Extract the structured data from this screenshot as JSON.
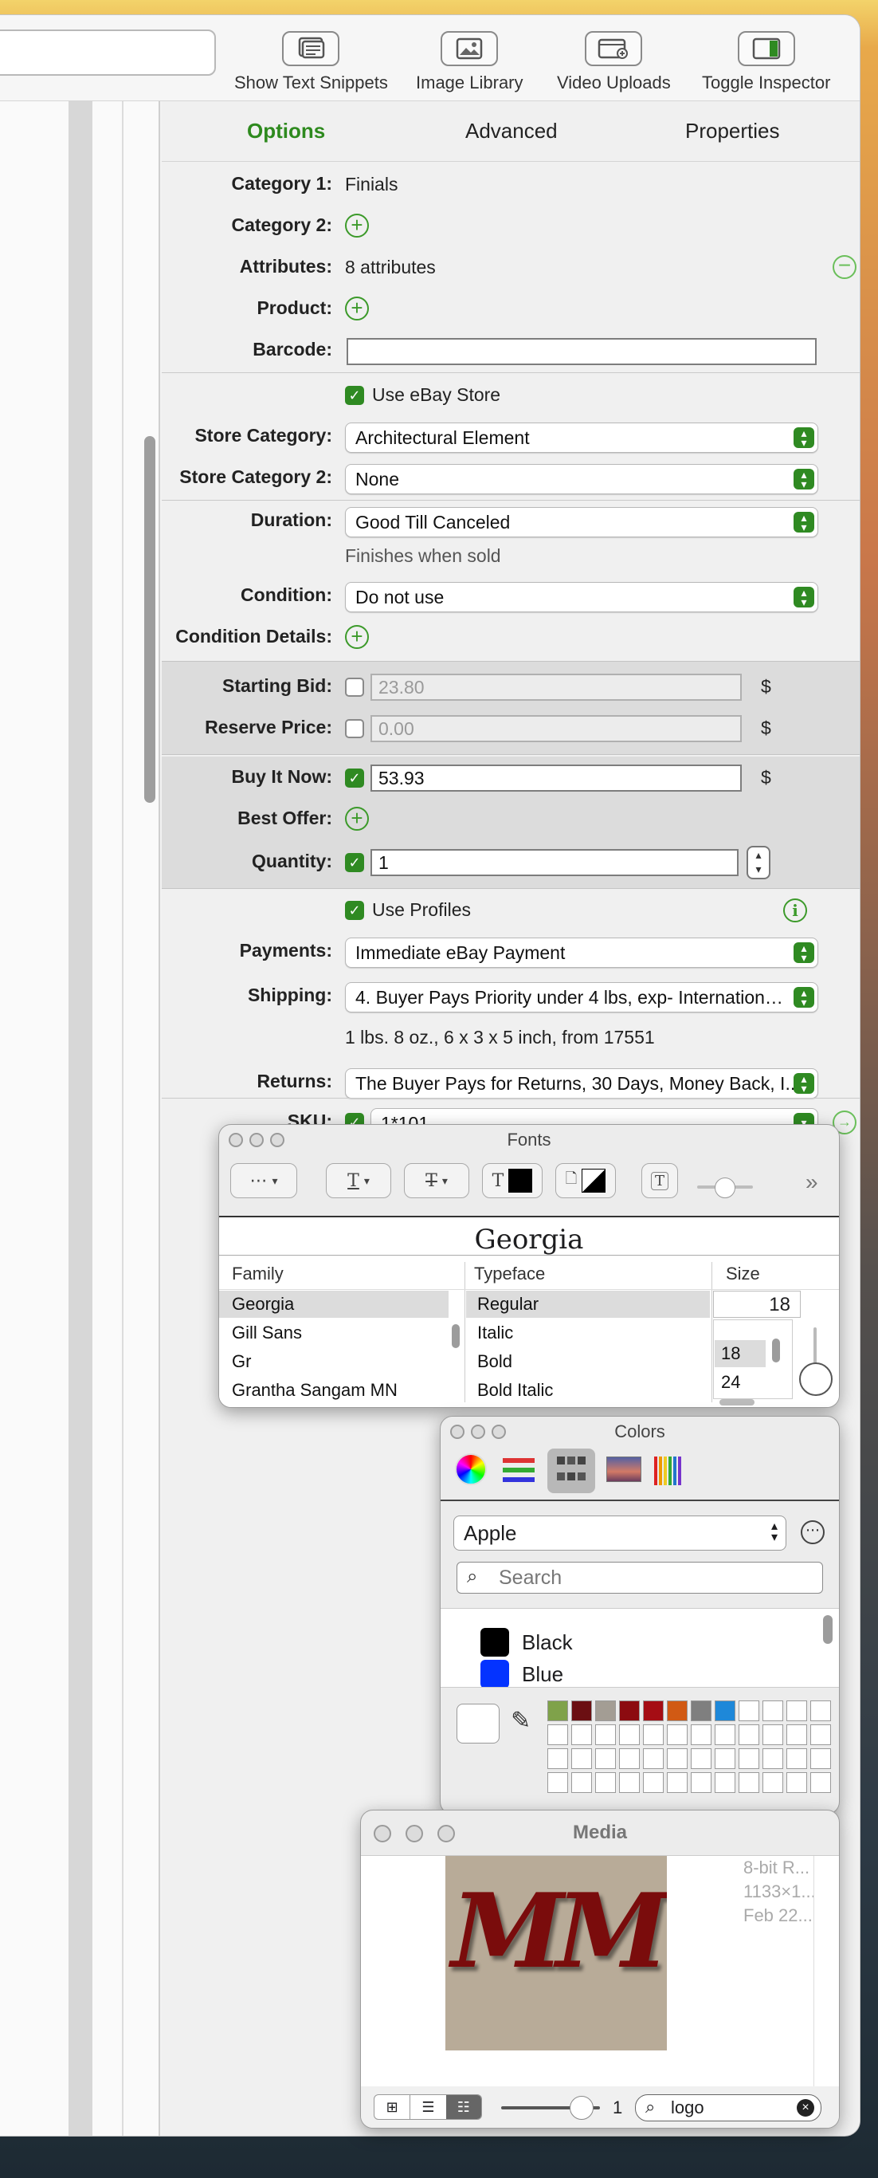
{
  "colors": {
    "accent": "#2f8a22",
    "logo_bg": "#b8ab98",
    "logo_fg": "#7a0c0c"
  },
  "toolbar": {
    "buttons": [
      {
        "label": "Show Text Snippets",
        "icon": "text-snippets-icon"
      },
      {
        "label": "Image Library",
        "icon": "image-library-icon"
      },
      {
        "label": "Video Uploads",
        "icon": "video-uploads-icon"
      },
      {
        "label": "Toggle Inspector",
        "icon": "toggle-inspector-icon"
      }
    ]
  },
  "inspector": {
    "tabs": {
      "options": "Options",
      "advanced": "Advanced",
      "properties": "Properties"
    },
    "category1": {
      "label": "Category 1:",
      "value": "Finials"
    },
    "category2": {
      "label": "Category 2:"
    },
    "attributes": {
      "label": "Attributes:",
      "value": "8 attributes"
    },
    "product": {
      "label": "Product:"
    },
    "barcode": {
      "label": "Barcode:",
      "value": ""
    },
    "ebay_store": {
      "label": "Use eBay Store"
    },
    "store_category": {
      "label": "Store Category:",
      "value": "Architectural Element"
    },
    "store_category2": {
      "label": "Store Category 2:",
      "value": "None"
    },
    "duration": {
      "label": "Duration:",
      "value": "Good Till Canceled",
      "note": "Finishes when sold"
    },
    "condition": {
      "label": "Condition:",
      "value": "Do not use"
    },
    "condition_details": {
      "label": "Condition Details:"
    },
    "starting_bid": {
      "label": "Starting Bid:",
      "value": "23.80",
      "currency": "$"
    },
    "reserve_price": {
      "label": "Reserve Price:",
      "value": "0.00",
      "currency": "$"
    },
    "buy_it_now": {
      "label": "Buy It Now:",
      "value": "53.93",
      "currency": "$"
    },
    "best_offer": {
      "label": "Best Offer:"
    },
    "quantity": {
      "label": "Quantity:",
      "value": "1"
    },
    "use_profiles": {
      "label": "Use Profiles"
    },
    "payments": {
      "label": "Payments:",
      "value": "Immediate eBay Payment"
    },
    "shipping": {
      "label": "Shipping:",
      "value": "4. Buyer Pays Priority under 4 lbs, exp- Internationa...",
      "note": "1 lbs. 8 oz., 6 x 3 x 5 inch, from 17551"
    },
    "returns": {
      "label": "Returns:",
      "value": "The Buyer Pays for Returns, 30 Days, Money Back, I..."
    },
    "sku": {
      "label": "SKU:",
      "value": "1*101"
    }
  },
  "fonts_panel": {
    "title": "Fonts",
    "preview": "Georgia",
    "headers": {
      "family": "Family",
      "typeface": "Typeface",
      "size": "Size"
    },
    "families": [
      "Georgia",
      "Gill Sans",
      "Gr",
      "Grantha Sangam MN"
    ],
    "typefaces": [
      "Regular",
      "Italic",
      "Bold",
      "Bold Italic"
    ],
    "size_value": "18",
    "sizes": [
      "18",
      "24"
    ]
  },
  "colors_panel": {
    "title": "Colors",
    "palette": "Apple",
    "search_placeholder": "Search",
    "color_names": [
      {
        "name": "Black",
        "hex": "#000000"
      },
      {
        "name": "Blue",
        "hex": "#0433ff"
      }
    ],
    "swatches": [
      "#7fa24a",
      "#6b0f12",
      "#a39d94",
      "#8c0b10",
      "#a50d14",
      "#d15a14",
      "#7f7f7f",
      "#1e88d9"
    ]
  },
  "media_panel": {
    "title": "Media",
    "info_lines": [
      "8-bit R...",
      "1133×1...",
      "Feb 22..."
    ],
    "logo_text": "MM",
    "count": "1",
    "search_value": "logo"
  }
}
